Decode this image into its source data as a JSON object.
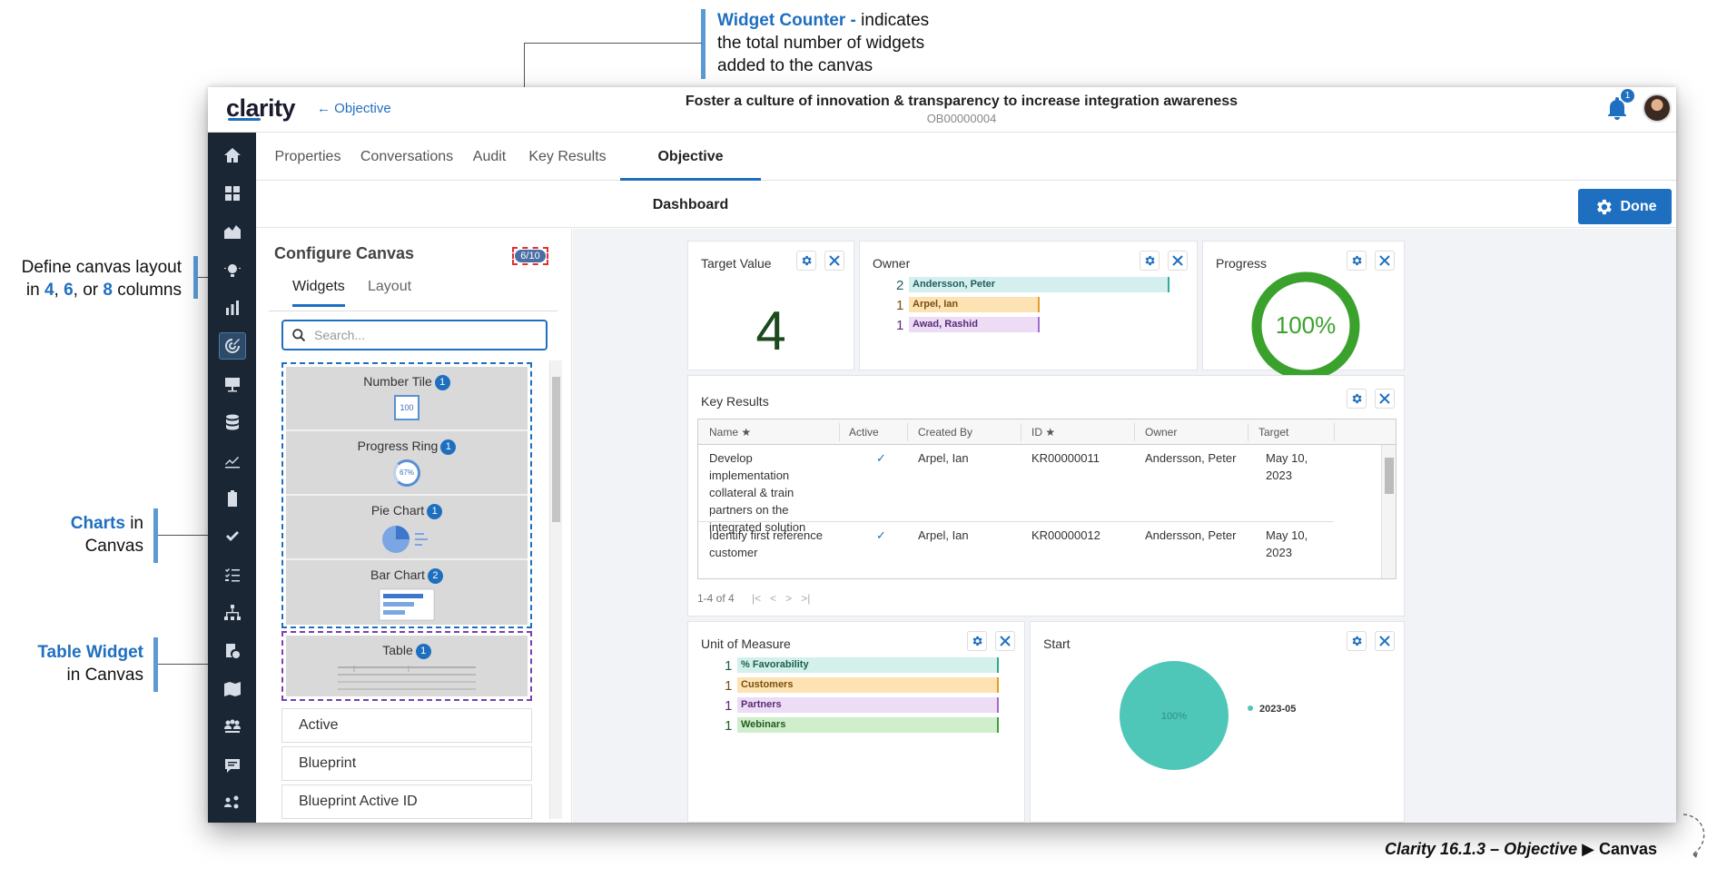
{
  "callouts": {
    "widget_counter_title": "Widget Counter -",
    "widget_counter_line1": " indicates",
    "widget_counter_line2": "the total number of widgets",
    "widget_counter_line3": "added to the canvas",
    "layout_line1": "Define canvas layout",
    "layout_in": "in ",
    "layout_n1": "4",
    "layout_sep1": ", ",
    "layout_n2": "6",
    "layout_sep2": ", or ",
    "layout_n3": "8",
    "layout_tail": " columns",
    "charts_title": "Charts",
    "charts_in": " in",
    "charts_line2": "Canvas",
    "table_title": "Table Widget",
    "table_line2": "in Canvas"
  },
  "topbar": {
    "logo": "clarity",
    "back_label": "← Objective",
    "title": "Foster a culture of innovation & transparency to increase integration awareness",
    "code": "OB00000004",
    "notification_count": "1"
  },
  "tabs": [
    "Properties",
    "Conversations",
    "Audit",
    "Key Results",
    "Objective Dashboard"
  ],
  "actions": {
    "done_label": "Done"
  },
  "config": {
    "title": "Configure Canvas",
    "counter": "6/10",
    "tab_widgets": "Widgets",
    "tab_layout": "Layout",
    "search_placeholder": "Search...",
    "widgets": [
      {
        "label": "Number Tile",
        "count": "1",
        "preview": "100"
      },
      {
        "label": "Progress Ring",
        "count": "1",
        "preview": "67%"
      },
      {
        "label": "Pie Chart",
        "count": "1"
      },
      {
        "label": "Bar Chart",
        "count": "2"
      }
    ],
    "table_widget": {
      "label": "Table",
      "count": "1"
    },
    "fields": [
      "Active",
      "Blueprint",
      "Blueprint Active ID"
    ]
  },
  "canvas": {
    "target": {
      "title": "Target Value",
      "value": "4"
    },
    "owner": {
      "title": "Owner",
      "rows": [
        {
          "n": "2",
          "label": "Andersson, Peter",
          "fraction": 1.0,
          "color": "#d5efef",
          "edge": "#33aaa0",
          "text": "#1f5f5a"
        },
        {
          "n": "1",
          "label": "Arpel, Ian",
          "fraction": 0.5,
          "color": "#fde2b3",
          "edge": "#e89a2a",
          "text": "#7a4f10"
        },
        {
          "n": "1",
          "label": "Awad, Rashid",
          "fraction": 0.5,
          "color": "#ecdcf5",
          "edge": "#a46bc9",
          "text": "#5a2b7a"
        }
      ]
    },
    "progress": {
      "title": "Progress",
      "value": "100%",
      "fraction": 1.0,
      "color": "#3aa22c"
    },
    "key_results": {
      "title": "Key Results",
      "columns": [
        "Name ★",
        "Active",
        "Created By",
        "ID ★",
        "Owner",
        "Target"
      ],
      "rows": [
        {
          "name": "Develop implementation collateral & train partners on the integrated solution",
          "active": "✓",
          "created_by": "Arpel, Ian",
          "id": "KR00000011",
          "owner": "Andersson, Peter",
          "target": "May 10, 2023"
        },
        {
          "name": "Identify first reference customer",
          "active": "✓",
          "created_by": "Arpel, Ian",
          "id": "KR00000012",
          "owner": "Andersson, Peter",
          "target": "May 10, 2023"
        }
      ],
      "pager": "1-4 of 4",
      "pager_icons": "|<   <   >   >|"
    },
    "unit_of_measure": {
      "title": "Unit of Measure",
      "rows": [
        {
          "n": "1",
          "label": "% Favorability",
          "color": "#d3f0ea",
          "edge": "#2ea889",
          "text": "#1b5e50"
        },
        {
          "n": "1",
          "label": "Customers",
          "color": "#fde2b3",
          "edge": "#e89a2a",
          "text": "#7a4f10"
        },
        {
          "n": "1",
          "label": "Partners",
          "color": "#ecdcf5",
          "edge": "#a46bc9",
          "text": "#5a2b7a"
        },
        {
          "n": "1",
          "label": "Webinars",
          "color": "#cfeecb",
          "edge": "#3f9f3a",
          "text": "#235c20"
        }
      ]
    },
    "start": {
      "title": "Start",
      "slice_label": "100%",
      "legend": "2023-05",
      "color": "#4ec7b8"
    }
  },
  "caption": {
    "text1": "Clarity 16.1.3 – Objective ",
    "arrow": "▶",
    "text2": " Canvas"
  }
}
